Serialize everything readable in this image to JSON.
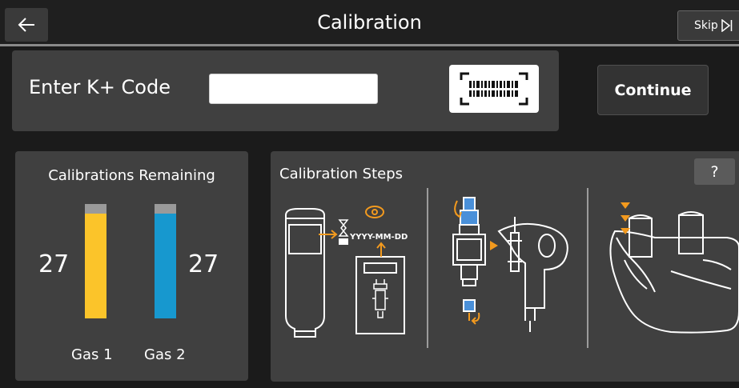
{
  "header": {
    "title": "Calibration",
    "back_icon": "arrow-left-icon",
    "skip_label": "Skip",
    "skip_icon": "skip-forward-icon"
  },
  "code_entry": {
    "label": "Enter K+ Code",
    "input_value": "",
    "input_placeholder": "",
    "scan_icon": "barcode-scan-icon"
  },
  "continue_label": "Continue",
  "calibrations": {
    "title": "Calibrations Remaining",
    "gases": [
      {
        "label": "Gas 1",
        "count": "27",
        "color": "#fbc42a"
      },
      {
        "label": "Gas 2",
        "count": "27",
        "color": "#1798cf"
      }
    ]
  },
  "steps": {
    "title": "Calibration Steps",
    "help_label": "?",
    "date_format": "YYYY-MM-DD",
    "accent_color": "#f39a1e",
    "highlight_color": "#4a90d9"
  }
}
